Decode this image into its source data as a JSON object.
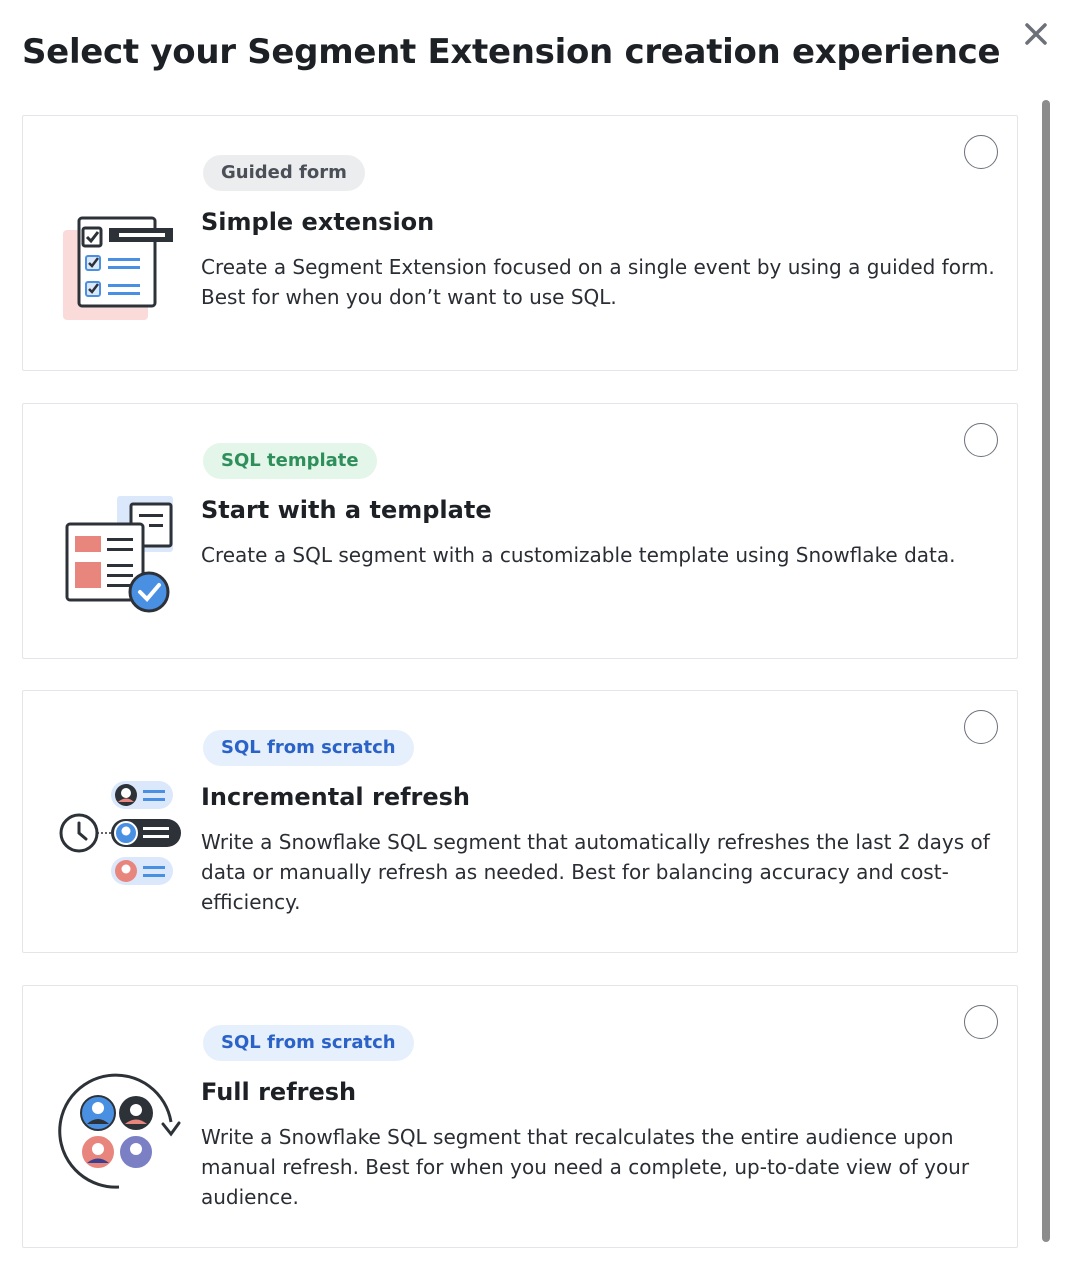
{
  "modal": {
    "title": "Select your Segment Extension creation experience",
    "close_icon": "close-icon"
  },
  "colors": {
    "border": "#e3e5e8",
    "badge_gray_bg": "#ebedef",
    "badge_green_bg": "#e4f5ea",
    "badge_green_text": "#2f8f5b",
    "badge_blue_bg": "#e6effc",
    "badge_blue_text": "#2b62c8",
    "illustration_blue": "#4a90e2",
    "illustration_red": "#e8867d",
    "illustration_dark": "#2d3238"
  },
  "options": [
    {
      "badge": "Guided form",
      "badge_style": "gray",
      "title": "Simple extension",
      "description": "Create a Segment Extension focused on a single event by using a guided form. Best for when you don’t want to use SQL.",
      "icon": "checklist-form-icon",
      "selected": false
    },
    {
      "badge": "SQL template",
      "badge_style": "green",
      "title": "Start with a template",
      "description": "Create a SQL segment with a customizable template using Snowflake data.",
      "icon": "template-document-icon",
      "selected": false
    },
    {
      "badge": "SQL from scratch",
      "badge_style": "blue",
      "title": "Incremental refresh",
      "description": "Write a Snowflake SQL segment that automatically refreshes the last 2 days of data or manually refresh as needed. Best for balancing accuracy and cost-efficiency.",
      "icon": "clock-users-icon",
      "selected": false
    },
    {
      "badge": "SQL from scratch",
      "badge_style": "blue",
      "title": "Full refresh",
      "description": "Write a Snowflake SQL segment that recalculates the entire audience upon manual refresh. Best for when you need a complete, up-to-date view of your audience.",
      "icon": "refresh-audience-icon",
      "selected": false
    }
  ]
}
